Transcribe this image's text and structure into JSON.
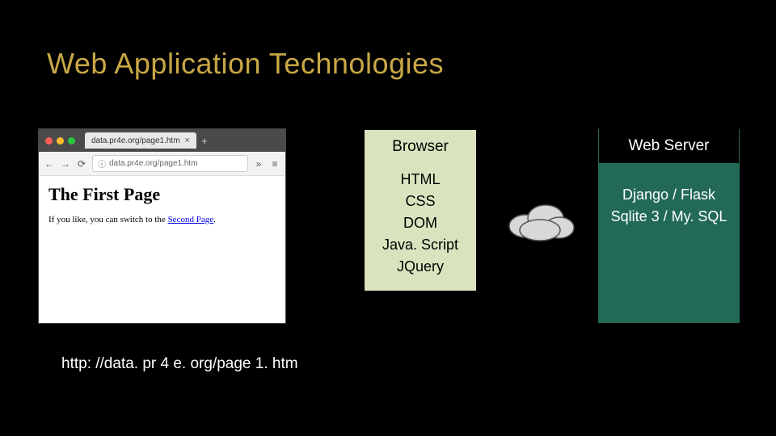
{
  "title": "Web Application Technologies",
  "browser_mock": {
    "tab_title": "data.pr4e.org/page1.htm",
    "tab_close": "×",
    "tab_plus": "+",
    "nav_back": "←",
    "nav_fwd": "→",
    "nav_reload": "⟳",
    "addr_prefix": "ⓘ",
    "addr_text": "data.pr4e.org/page1.htm",
    "nav_more": "»",
    "nav_menu": "≡",
    "page_heading": "The First Page",
    "page_text_before": "If you like, you can switch to the ",
    "page_link": "Second Page",
    "page_text_after": "."
  },
  "browser_box": {
    "header": "Browser",
    "tech": [
      "HTML",
      "CSS",
      "DOM",
      "Java. Script",
      "JQuery"
    ]
  },
  "server_box": {
    "header": "Web Server",
    "tech": [
      "Django / Flask",
      "Sqlite 3 / My. SQL"
    ]
  },
  "url_caption": "http: //data. pr 4 e. org/page 1. htm"
}
